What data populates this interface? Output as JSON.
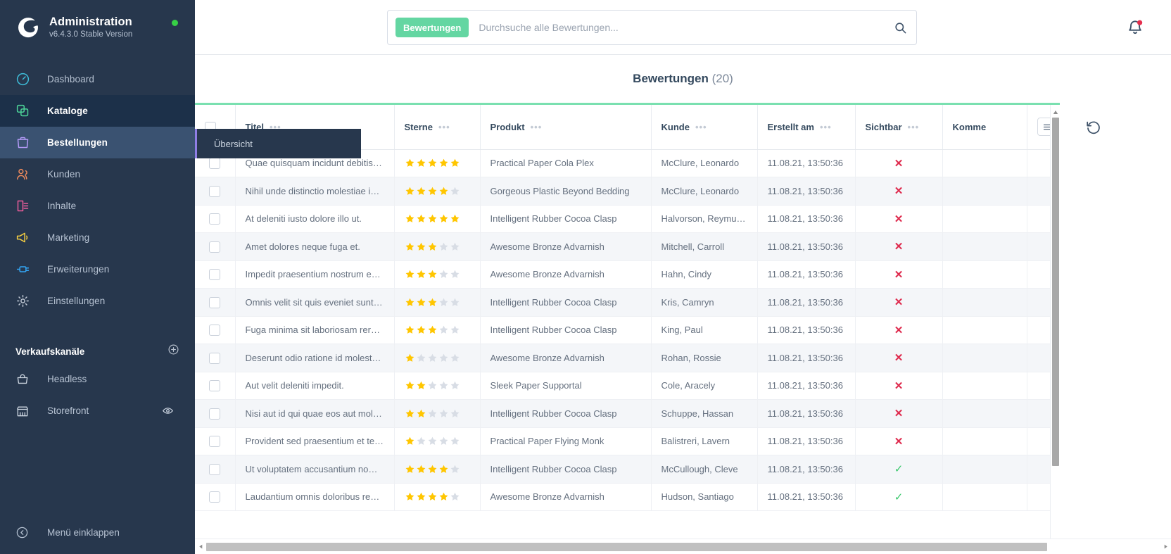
{
  "sidebar": {
    "brand": {
      "title": "Administration",
      "version": "v6.4.3.0 Stable Version",
      "status_color": "#37d046"
    },
    "items": [
      {
        "label": "Dashboard",
        "icon": "dashboard-icon",
        "color": "#3ebcd8",
        "state": ""
      },
      {
        "label": "Kataloge",
        "icon": "catalog-icon",
        "color": "#4dd599",
        "state": "open"
      },
      {
        "label": "Bestellungen",
        "icon": "orders-icon",
        "color": "#b39af7",
        "state": "active"
      },
      {
        "label": "Kunden",
        "icon": "customers-icon",
        "color": "#f08b5c",
        "state": ""
      },
      {
        "label": "Inhalte",
        "icon": "content-icon",
        "color": "#ea5d9b",
        "state": ""
      },
      {
        "label": "Marketing",
        "icon": "marketing-icon",
        "color": "#f7d041",
        "state": ""
      },
      {
        "label": "Erweiterungen",
        "icon": "extensions-icon",
        "color": "#33a6f5",
        "state": ""
      },
      {
        "label": "Einstellungen",
        "icon": "settings-gear-icon",
        "color": "#c2cad6",
        "state": ""
      }
    ],
    "sales_channels": {
      "title": "Verkaufskanäle",
      "add_icon": "plus-circle-icon",
      "items": [
        {
          "label": "Headless",
          "icon": "basket-icon",
          "trailing_icon": ""
        },
        {
          "label": "Storefront",
          "icon": "storefront-icon",
          "trailing_icon": "eye-icon"
        }
      ]
    },
    "collapse": {
      "label": "Menü einklappen",
      "icon": "collapse-arrow-icon"
    }
  },
  "flyout": {
    "items": [
      {
        "label": "Übersicht"
      }
    ],
    "accent_color": "#8f7ee6"
  },
  "topbar": {
    "search_tag": "Bewertungen",
    "search_placeholder": "Durchsuche alle Bewertungen...",
    "search_value": "",
    "search_icon": "search-icon",
    "notification_icon": "bell-icon",
    "notification_badge_color": "#e52e4d"
  },
  "page": {
    "title": "Bewertungen",
    "count": "(20)"
  },
  "grid": {
    "accent_color": "#7ae0b0",
    "settings_icon": "list-settings-icon",
    "refresh_icon": "refresh-icon",
    "column_menu_icon": "three-dots-icon",
    "row_action_icon": "three-dots-icon",
    "columns": [
      {
        "key": "select",
        "label": ""
      },
      {
        "key": "title",
        "label": "Titel"
      },
      {
        "key": "stars",
        "label": "Sterne"
      },
      {
        "key": "product",
        "label": "Produkt"
      },
      {
        "key": "customer",
        "label": "Kunde"
      },
      {
        "key": "created",
        "label": "Erstellt am"
      },
      {
        "key": "visible",
        "label": "Sichtbar"
      },
      {
        "key": "comment",
        "label": "Komme"
      },
      {
        "key": "actions",
        "label": ""
      }
    ],
    "rows": [
      {
        "title": "Quae quisquam incidunt debitis…",
        "stars": 5,
        "product": "Practical Paper Cola Plex",
        "customer": "McClure, Leonardo",
        "created": "11.08.21, 13:50:36",
        "visible": false,
        "comment": ""
      },
      {
        "title": "Nihil unde distinctio molestiae i…",
        "stars": 4,
        "product": "Gorgeous Plastic Beyond Bedding",
        "customer": "McClure, Leonardo",
        "created": "11.08.21, 13:50:36",
        "visible": false,
        "comment": ""
      },
      {
        "title": "At deleniti iusto dolore illo ut.",
        "stars": 5,
        "product": "Intelligent Rubber Cocoa Clasp",
        "customer": "Halvorson, Reymundo",
        "created": "11.08.21, 13:50:36",
        "visible": false,
        "comment": ""
      },
      {
        "title": "Amet dolores neque fuga et.",
        "stars": 3,
        "product": "Awesome Bronze Advarnish",
        "customer": "Mitchell, Carroll",
        "created": "11.08.21, 13:50:36",
        "visible": false,
        "comment": ""
      },
      {
        "title": "Impedit praesentium nostrum e…",
        "stars": 3,
        "product": "Awesome Bronze Advarnish",
        "customer": "Hahn, Cindy",
        "created": "11.08.21, 13:50:36",
        "visible": false,
        "comment": ""
      },
      {
        "title": "Omnis velit sit quis eveniet sunt…",
        "stars": 3,
        "product": "Intelligent Rubber Cocoa Clasp",
        "customer": "Kris, Camryn",
        "created": "11.08.21, 13:50:36",
        "visible": false,
        "comment": ""
      },
      {
        "title": "Fuga minima sit laboriosam rer…",
        "stars": 3,
        "product": "Intelligent Rubber Cocoa Clasp",
        "customer": "King, Paul",
        "created": "11.08.21, 13:50:36",
        "visible": false,
        "comment": ""
      },
      {
        "title": "Deserunt odio ratione id molest…",
        "stars": 1,
        "product": "Awesome Bronze Advarnish",
        "customer": "Rohan, Rossie",
        "created": "11.08.21, 13:50:36",
        "visible": false,
        "comment": ""
      },
      {
        "title": "Aut velit deleniti impedit.",
        "stars": 2,
        "product": "Sleek Paper Supportal",
        "customer": "Cole, Aracely",
        "created": "11.08.21, 13:50:36",
        "visible": false,
        "comment": ""
      },
      {
        "title": "Nisi aut id qui quae eos aut mol…",
        "stars": 2,
        "product": "Intelligent Rubber Cocoa Clasp",
        "customer": "Schuppe, Hassan",
        "created": "11.08.21, 13:50:36",
        "visible": false,
        "comment": ""
      },
      {
        "title": "Provident sed praesentium et te…",
        "stars": 1,
        "product": "Practical Paper Flying Monk",
        "customer": "Balistreri, Lavern",
        "created": "11.08.21, 13:50:36",
        "visible": false,
        "comment": ""
      },
      {
        "title": "Ut voluptatem accusantium no…",
        "stars": 4,
        "product": "Intelligent Rubber Cocoa Clasp",
        "customer": "McCullough, Cleve",
        "created": "11.08.21, 13:50:36",
        "visible": true,
        "comment": ""
      },
      {
        "title": "Laudantium omnis doloribus re…",
        "stars": 4,
        "product": "Awesome Bronze Advarnish",
        "customer": "Hudson, Santiago",
        "created": "11.08.21, 13:50:36",
        "visible": true,
        "comment": ""
      }
    ],
    "star_on_color": "#ffc600",
    "star_off_color": "#d8dde5",
    "visible_true_mark": "✓",
    "visible_false_mark": "✕"
  }
}
